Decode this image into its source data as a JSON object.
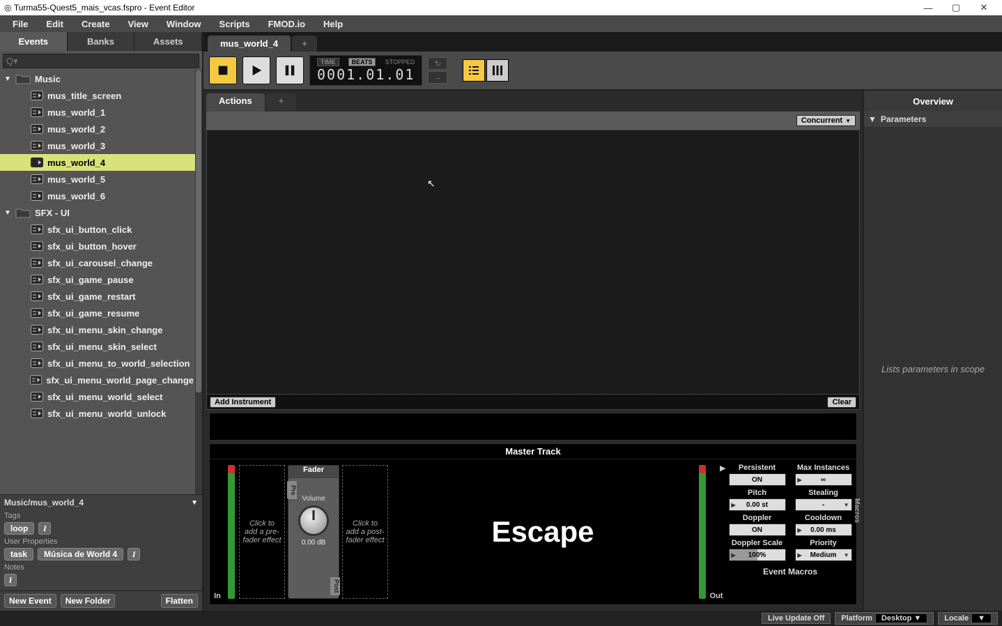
{
  "window": {
    "title": "Turma55-Quest5_mais_vcas.fspro - Event Editor",
    "min": "—",
    "max": "▢",
    "close": "✕"
  },
  "menubar": [
    "File",
    "Edit",
    "Create",
    "View",
    "Window",
    "Scripts",
    "FMOD.io",
    "Help"
  ],
  "left_tabs": {
    "events": "Events",
    "banks": "Banks",
    "assets": "Assets"
  },
  "search": {
    "placeholder": "Q▾"
  },
  "tree": {
    "folders": [
      {
        "name": "Music",
        "items": [
          "mus_title_screen",
          "mus_world_1",
          "mus_world_2",
          "mus_world_3",
          "mus_world_4",
          "mus_world_5",
          "mus_world_6"
        ],
        "selected_index": 4
      },
      {
        "name": "SFX - UI",
        "items": [
          "sfx_ui_button_click",
          "sfx_ui_button_hover",
          "sfx_ui_carousel_change",
          "sfx_ui_game_pause",
          "sfx_ui_game_restart",
          "sfx_ui_game_resume",
          "sfx_ui_menu_skin_change",
          "sfx_ui_menu_skin_select",
          "sfx_ui_menu_to_world_selection",
          "sfx_ui_menu_world_page_change",
          "sfx_ui_menu_world_select",
          "sfx_ui_menu_world_unlock"
        ]
      }
    ]
  },
  "details": {
    "path": "Music/mus_world_4",
    "tags_label": "Tags",
    "tags": [
      "loop"
    ],
    "userprops_label": "User Properties",
    "userprops": [
      {
        "k": "task",
        "v": "Música de World 4"
      }
    ],
    "notes_label": "Notes",
    "new_event": "New Event",
    "new_folder": "New Folder",
    "flatten": "Flatten"
  },
  "editor_tab": "mus_world_4",
  "transport": {
    "time_label": "TIME",
    "beats_label": "BEATS",
    "state": "STOPPED",
    "position": "0001.01.01"
  },
  "actions": {
    "tab": "Actions",
    "mode": "Concurrent",
    "add_instrument": "Add Instrument",
    "clear": "Clear"
  },
  "master": {
    "title": "Master Track",
    "in": "In",
    "out": "Out",
    "pre_hint": "Click to add a pre-fader effect",
    "post_hint": "Click to add a post-fader effect",
    "fader_title": "Fader",
    "pre_tab": "Pre",
    "post_tab": "Post",
    "volume_label": "Volume",
    "volume_value": "0.00 dB",
    "escape": "Escape"
  },
  "props": {
    "persistent": {
      "label": "Persistent",
      "value": "ON"
    },
    "max_instances": {
      "label": "Max Instances",
      "value": "∞"
    },
    "pitch": {
      "label": "Pitch",
      "value": "0.00 st"
    },
    "stealing": {
      "label": "Stealing",
      "value": "-"
    },
    "doppler": {
      "label": "Doppler",
      "value": "ON"
    },
    "cooldown": {
      "label": "Cooldown",
      "value": "0.00 ms"
    },
    "doppler_scale": {
      "label": "Doppler Scale",
      "value": "100%"
    },
    "priority": {
      "label": "Priority",
      "value": "Medium"
    },
    "macros_side": "Macros",
    "event_macros": "Event Macros"
  },
  "overview": {
    "title": "Overview",
    "parameters": "Parameters",
    "empty": "Lists parameters in scope"
  },
  "status": {
    "live_update": "Live Update Off",
    "platform_label": "Platform",
    "platform_value": "Desktop",
    "locale_label": "Locale",
    "locale_value": ""
  }
}
